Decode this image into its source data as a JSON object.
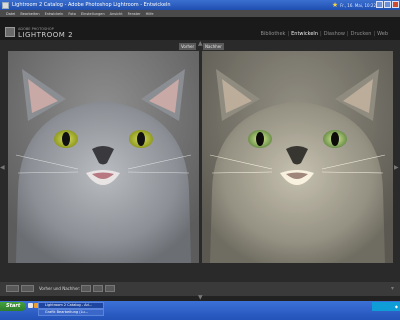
{
  "window": {
    "title": "Lightroom 2 Catalog - Adobe Photoshop Lightroom - Entwickeln",
    "clock": "Fr., 16. Mai, 10:22"
  },
  "menu": {
    "items": [
      "Datei",
      "Bearbeiten",
      "Entwickeln",
      "Foto",
      "Einstellungen",
      "Ansicht",
      "Fenster",
      "Hilfe"
    ]
  },
  "app": {
    "brand_top": "ADOBE PHOTOSHOP",
    "brand": "LIGHTROOM 2"
  },
  "modules": {
    "items": [
      {
        "label": "Bibliothek",
        "active": false
      },
      {
        "label": "Entwickeln",
        "active": true
      },
      {
        "label": "Diashow",
        "active": false
      },
      {
        "label": "Drucken",
        "active": false
      },
      {
        "label": "Web",
        "active": false
      }
    ]
  },
  "view": {
    "before_label": "Vorher",
    "after_label": "Nachher"
  },
  "toolbar": {
    "mode_label": "Vorher und Nachher:"
  },
  "taskbar": {
    "start_label": "Start",
    "tasks": [
      {
        "label": "Lightroom 2 Catalog - Ad...",
        "active": true
      },
      {
        "label": "Grafik Bearbeitung (Lu...",
        "active": false
      }
    ],
    "tray_icon": "network-icon"
  },
  "colors": {
    "titlebar": "#2a5fc4",
    "lr_background": "#1a1a1a",
    "active_module": "#f0f0f0",
    "taskbar": "#2f63cc",
    "start": "#3a8f35"
  }
}
